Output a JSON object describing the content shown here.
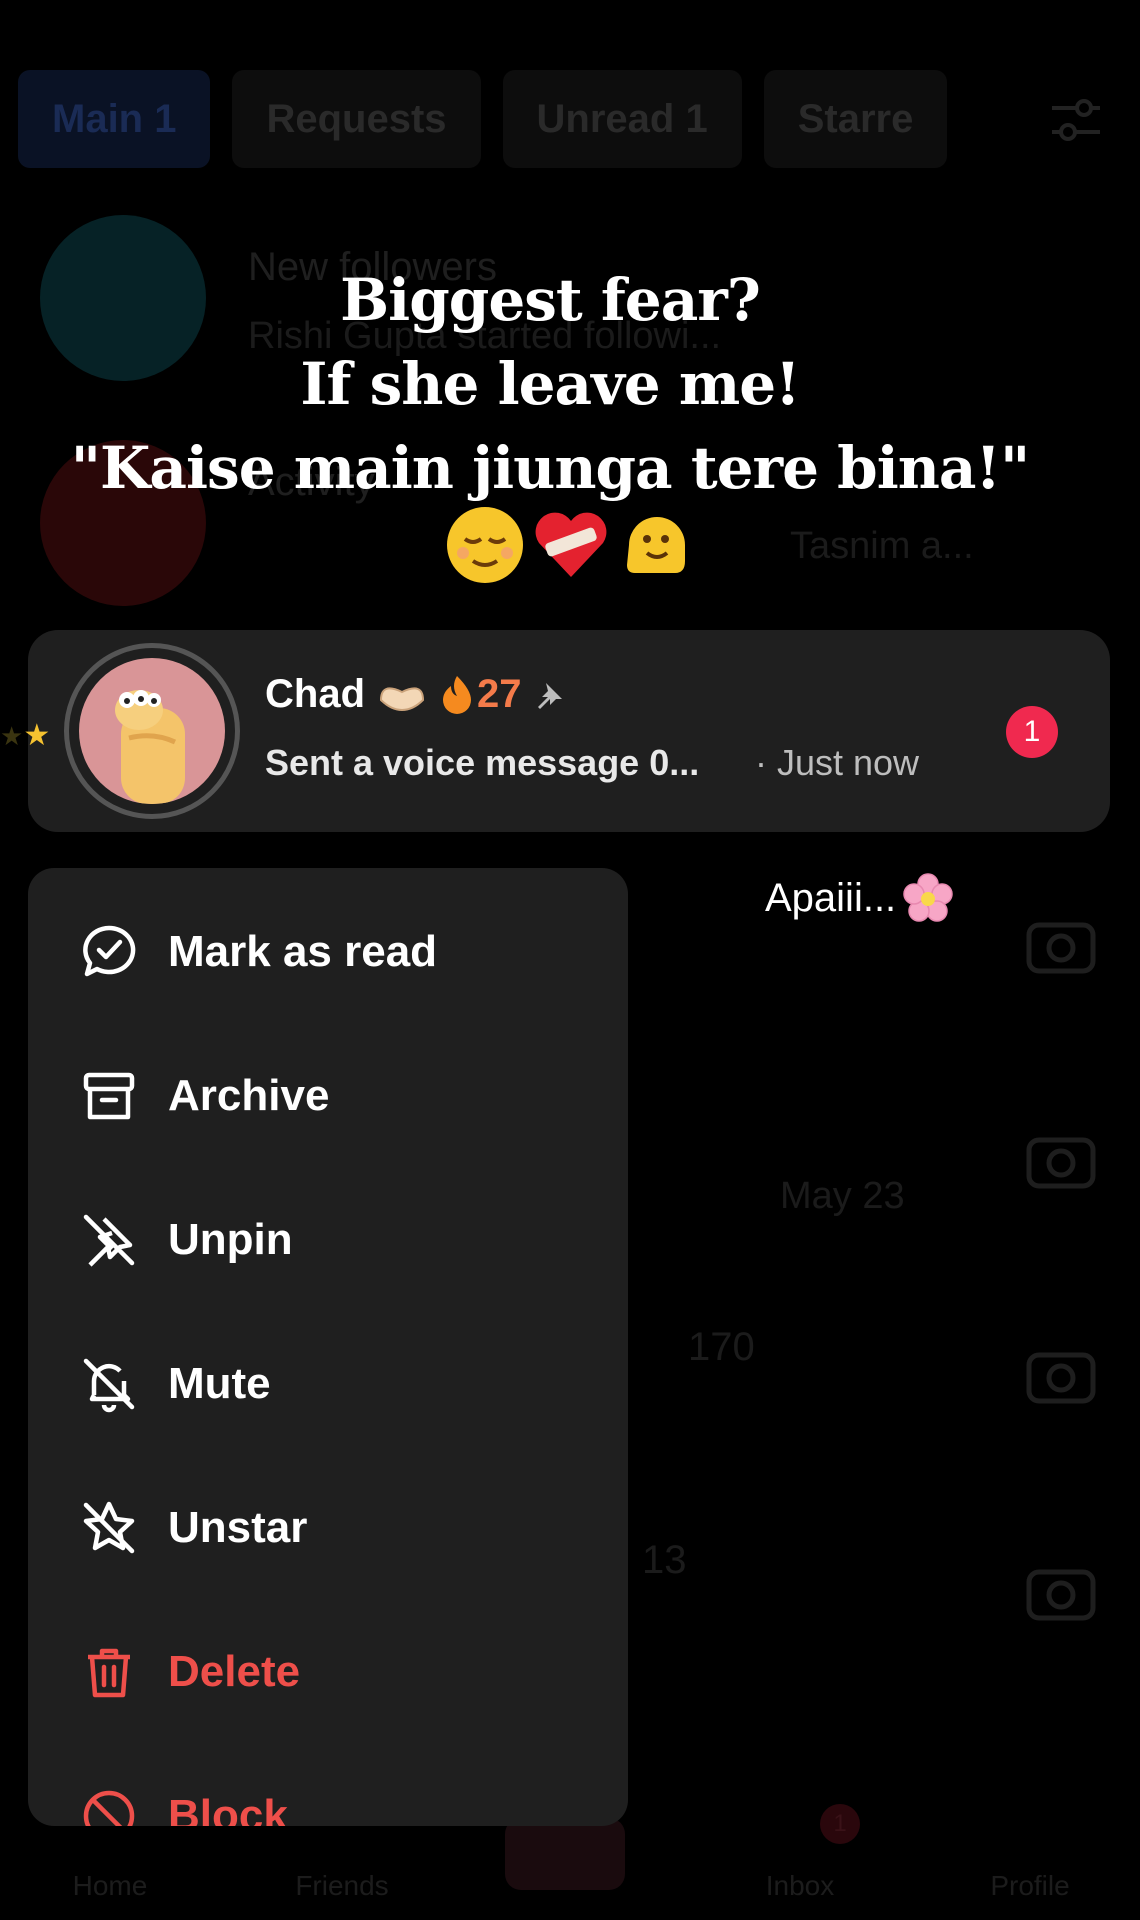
{
  "tabs": [
    {
      "label": "Main 1"
    },
    {
      "label": "Requests"
    },
    {
      "label": "Unread 1"
    },
    {
      "label": "Starre"
    }
  ],
  "background_rows": [
    {
      "title": "New followers",
      "subtitle": "Rishi Gupta started followi..."
    },
    {
      "title": "Activity",
      "subtitle": "Tasnim a..."
    }
  ],
  "background_faint": {
    "date": "May 23",
    "count_a": "170",
    "count_b": "13"
  },
  "caption": {
    "line1": "Biggest fear?",
    "line2": "If she leave me!",
    "line3": "\"Kaise main jiunga tere bina!\""
  },
  "chat": {
    "name": "Chad",
    "streak_count": "27",
    "preview": "Sent a voice message 0...",
    "time": "· Just now",
    "unread_count": "1"
  },
  "side_text": "Apaiii...",
  "menu": {
    "items": [
      {
        "label": "Mark as read",
        "icon": "check-bubble-icon"
      },
      {
        "label": "Archive",
        "icon": "archive-icon"
      },
      {
        "label": "Unpin",
        "icon": "unpin-icon"
      },
      {
        "label": "Mute",
        "icon": "mute-bell-icon"
      },
      {
        "label": "Unstar",
        "icon": "unstar-icon"
      },
      {
        "label": "Delete",
        "icon": "trash-icon"
      },
      {
        "label": "Block",
        "icon": "block-icon"
      }
    ]
  },
  "bottom_nav": {
    "home": "Home",
    "friends": "Friends",
    "inbox": "Inbox",
    "inbox_badge": "1",
    "profile": "Profile"
  },
  "colors": {
    "danger": "#ee4f4a",
    "badge": "#f0294f",
    "streak": "#f47b4a",
    "menu_bg": "#1f1f1f"
  }
}
